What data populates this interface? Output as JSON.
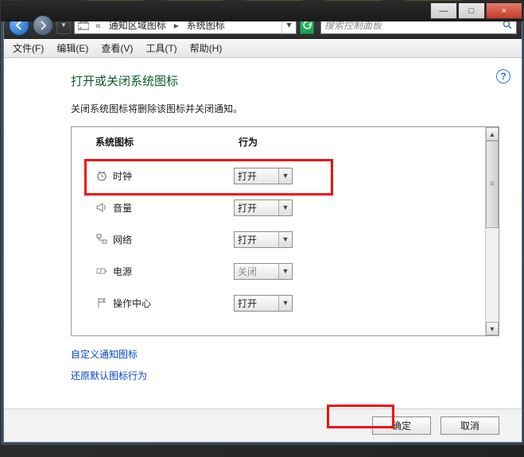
{
  "window": {
    "minimize": "—",
    "maximize": "□",
    "close": "×"
  },
  "nav": {
    "double_left": "«",
    "crumb1": "通知区域图标",
    "crumb2": "系统图标",
    "search_placeholder": "搜索控制面板"
  },
  "menu": {
    "file": "文件(F)",
    "edit": "编辑(E)",
    "view": "查看(V)",
    "tools": "工具(T)",
    "help": "帮助(H)"
  },
  "page": {
    "heading": "打开或关闭系统图标",
    "desc": "关闭系统图标将删除该图标并关闭通知。",
    "col_icon": "系统图标",
    "col_action": "行为",
    "help": "?"
  },
  "rows": [
    {
      "label": "时钟",
      "value": "打开",
      "disabled": false
    },
    {
      "label": "音量",
      "value": "打开",
      "disabled": false
    },
    {
      "label": "网络",
      "value": "打开",
      "disabled": false
    },
    {
      "label": "电源",
      "value": "关闭",
      "disabled": true
    },
    {
      "label": "操作中心",
      "value": "打开",
      "disabled": false
    }
  ],
  "links": {
    "customize": "自定义通知图标",
    "restore": "还原默认图标行为"
  },
  "footer": {
    "ok": "确定",
    "cancel": "取消"
  }
}
